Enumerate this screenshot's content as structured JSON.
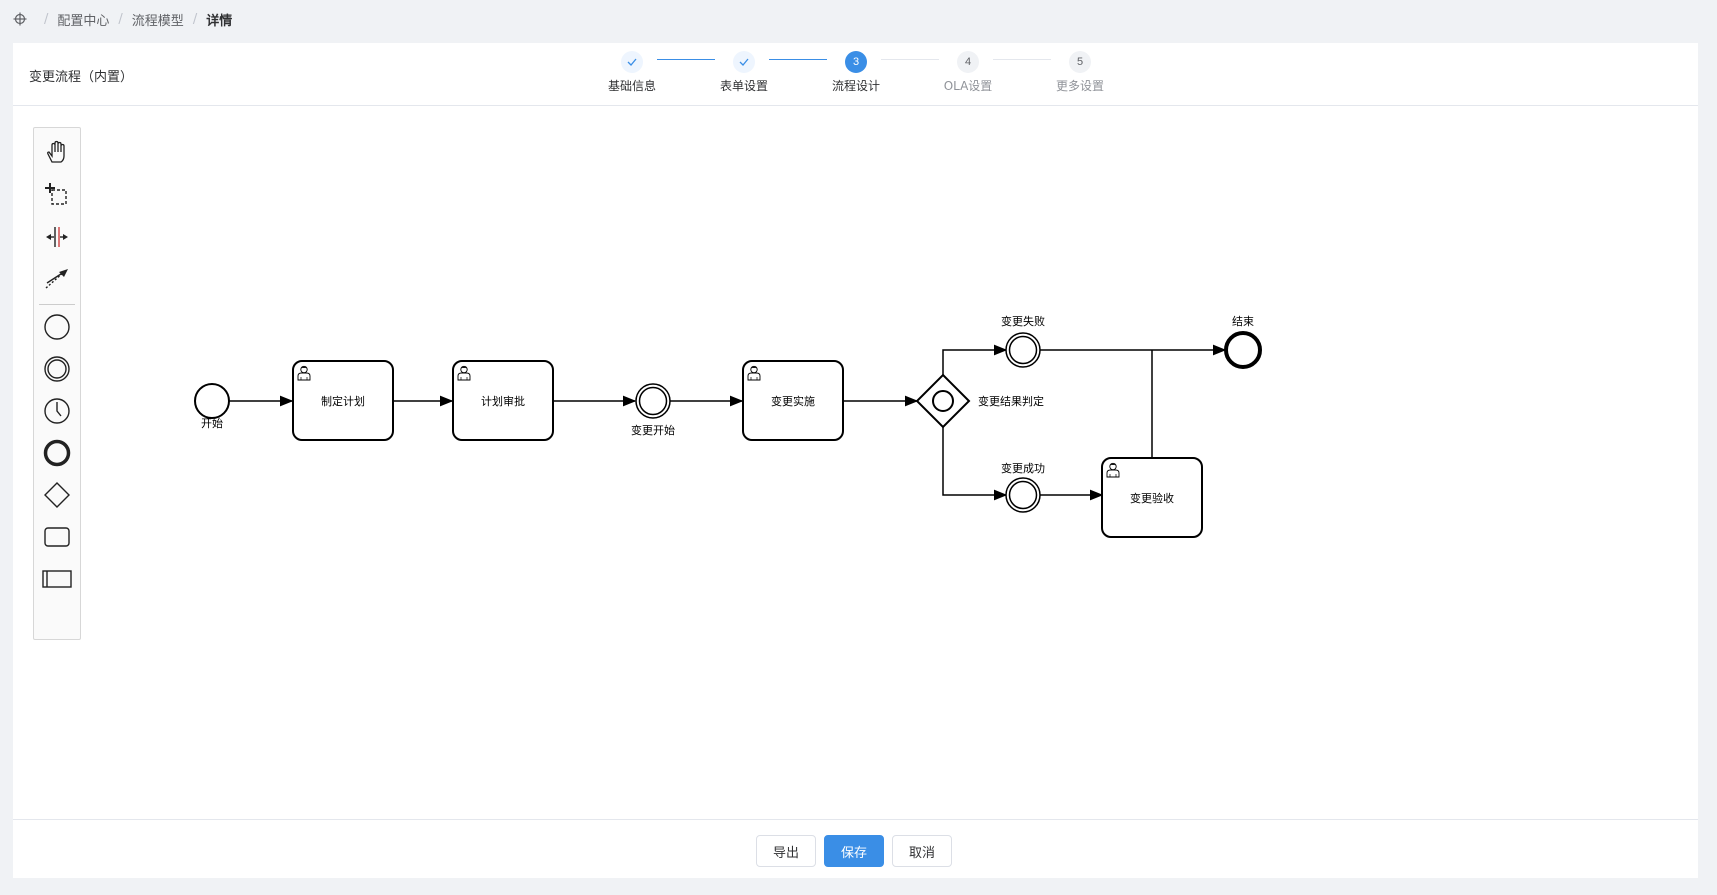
{
  "breadcrumb": {
    "home_icon": "move-icon",
    "items": [
      "配置中心",
      "流程模型",
      "详情"
    ],
    "separator": "/"
  },
  "header": {
    "title": "变更流程（内置）"
  },
  "steps": [
    {
      "index": "1",
      "label": "基础信息",
      "status": "done"
    },
    {
      "index": "2",
      "label": "表单设置",
      "status": "done"
    },
    {
      "index": "3",
      "label": "流程设计",
      "status": "active"
    },
    {
      "index": "4",
      "label": "OLA设置",
      "status": "todo"
    },
    {
      "index": "5",
      "label": "更多设置",
      "status": "todo"
    }
  ],
  "palette": {
    "tools": [
      "hand-tool-icon",
      "lasso-tool-icon",
      "space-tool-icon",
      "connect-tool-icon",
      "start-event-icon",
      "intermediate-event-icon",
      "timer-event-icon",
      "end-event-icon",
      "gateway-icon",
      "task-icon",
      "pool-icon"
    ]
  },
  "diagram": {
    "start_label": "开始",
    "task_plan": "制定计划",
    "task_approve": "计划审批",
    "event_change_start": "变更开始",
    "task_implement": "变更实施",
    "gateway_label": "变更结果判定",
    "event_fail": "变更失败",
    "event_success": "变更成功",
    "task_accept": "变更验收",
    "end_label": "结束"
  },
  "footer": {
    "export_label": "导出",
    "save_label": "保存",
    "cancel_label": "取消"
  },
  "colors": {
    "primary": "#3a8ee6",
    "background": "#f0f2f5"
  }
}
